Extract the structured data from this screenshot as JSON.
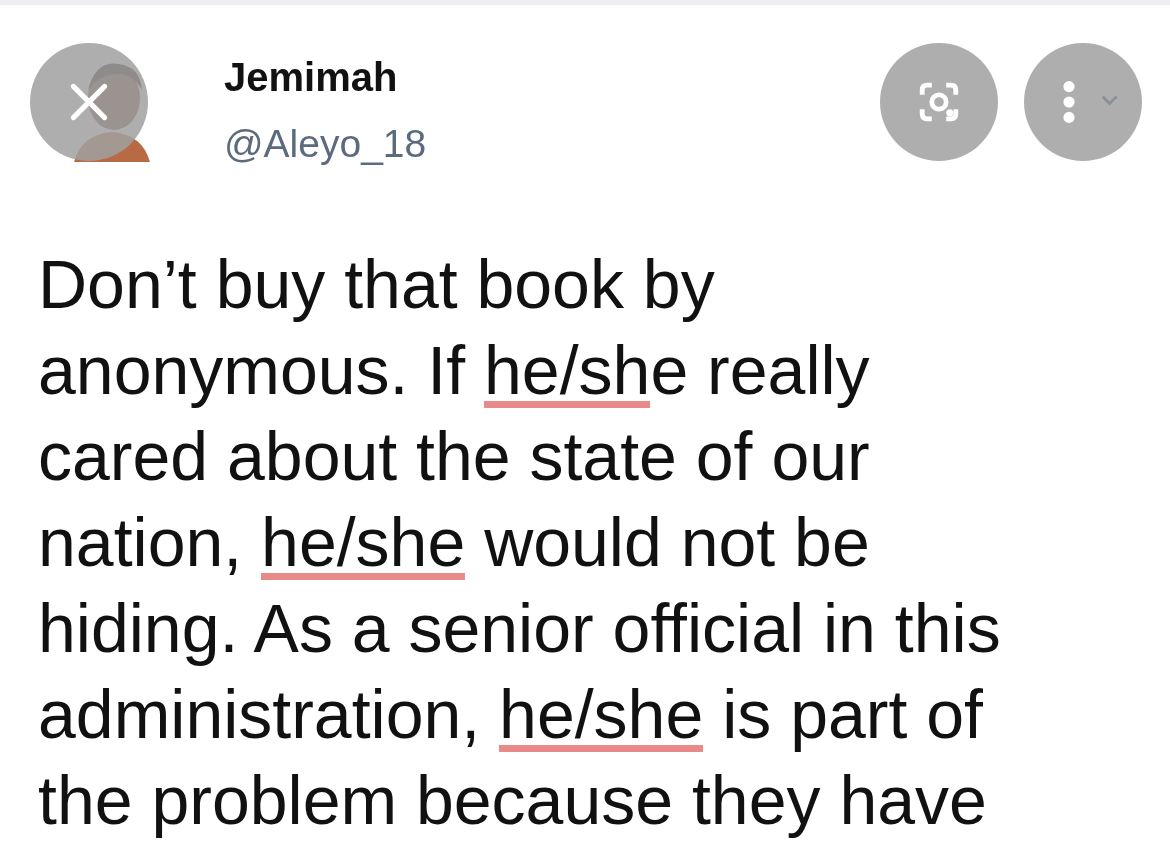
{
  "tweet": {
    "name": "Jemimah",
    "handle": "@Aleyo_18",
    "lines": [
      [
        {
          "text": "Don’t buy that book by",
          "marked": false
        }
      ],
      [
        {
          "text": "anonymous. If ",
          "marked": false
        },
        {
          "text": "he/sh",
          "marked": true
        },
        {
          "text": "e really",
          "marked": false
        }
      ],
      [
        {
          "text": "cared about the state of our",
          "marked": false
        }
      ],
      [
        {
          "text": "nation, ",
          "marked": false
        },
        {
          "text": "he/she",
          "marked": true
        },
        {
          "text": " would not be",
          "marked": false
        }
      ],
      [
        {
          "text": "hiding. As a senior official in this",
          "marked": false
        }
      ],
      [
        {
          "text": "administration, ",
          "marked": false
        },
        {
          "text": "he/she",
          "marked": true
        },
        {
          "text": " is part of",
          "marked": false
        }
      ],
      [
        {
          "text": "the problem because they have",
          "marked": false
        }
      ]
    ]
  }
}
